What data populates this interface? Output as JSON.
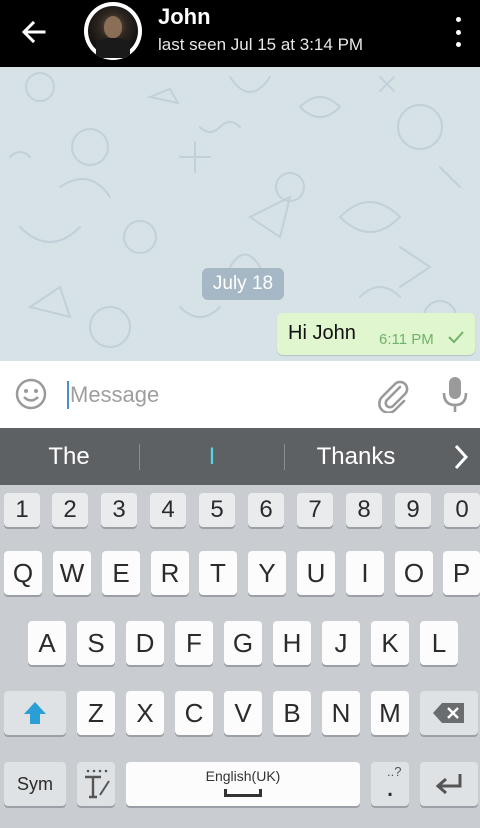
{
  "header": {
    "contact_name": "John",
    "status": "last seen Jul 15 at 3:14 PM"
  },
  "chat": {
    "date_chip": "July 18",
    "messages": [
      {
        "text": "Hi John",
        "time": "6:11 PM",
        "outgoing": true,
        "status": "sent"
      }
    ]
  },
  "composer": {
    "placeholder": "Message",
    "value": ""
  },
  "suggestions": [
    "The",
    "I",
    "Thanks"
  ],
  "keyboard": {
    "number_row": [
      "1",
      "2",
      "3",
      "4",
      "5",
      "6",
      "7",
      "8",
      "9",
      "0"
    ],
    "row1": [
      "Q",
      "W",
      "E",
      "R",
      "T",
      "Y",
      "U",
      "I",
      "O",
      "P"
    ],
    "row2": [
      "A",
      "S",
      "D",
      "F",
      "G",
      "H",
      "J",
      "K",
      "L"
    ],
    "row3": [
      "Z",
      "X",
      "C",
      "V",
      "B",
      "N",
      "M"
    ],
    "sym_label": "Sym",
    "space_label": "English(UK)",
    "punct_hint": "..?",
    "punct_main": "."
  },
  "colors": {
    "header_bg": "#000000",
    "chat_bg": "#d7e2e7",
    "outgoing_bubble": "#e0f6cf",
    "check_color": "#6fb36a",
    "suggest_highlight": "#5ad3e0",
    "shift_active": "#2a9fd6"
  },
  "icons": {
    "back": "arrow-left-icon",
    "menu": "more-vertical-icon",
    "emoji": "smile-icon",
    "attach": "paperclip-icon",
    "mic": "microphone-icon",
    "suggest_more": "chevron-right-icon",
    "shift": "shift-arrow-icon",
    "backspace": "backspace-icon",
    "handwriting": "handwriting-t-icon",
    "enter": "enter-icon"
  }
}
